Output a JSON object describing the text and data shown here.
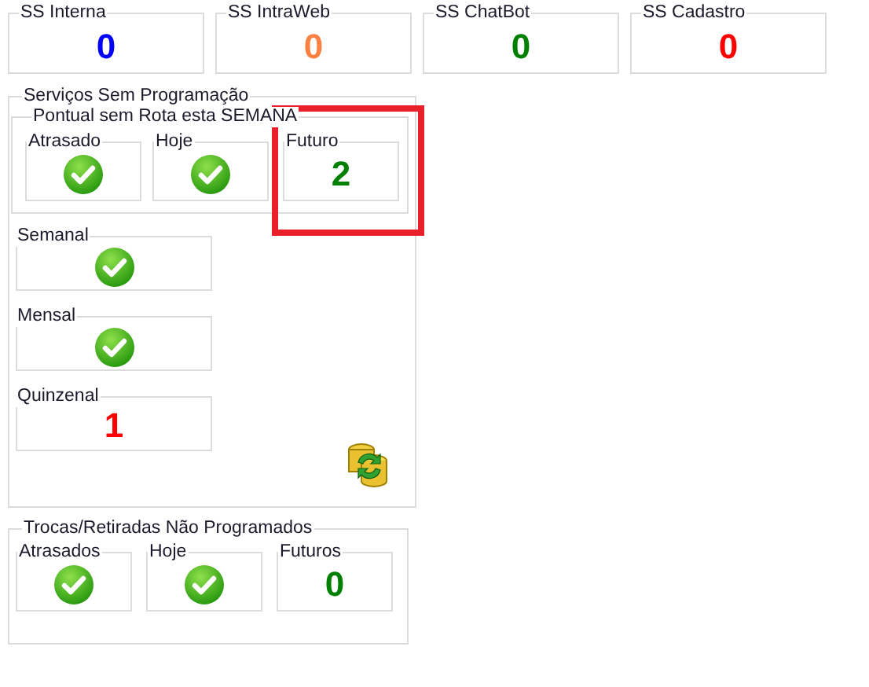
{
  "summary": [
    {
      "label": "SS Interna",
      "kind": "count",
      "value": "0",
      "color": "#0000ff"
    },
    {
      "label": "SS IntraWeb",
      "kind": "count",
      "value": "0",
      "color": "#ff8040"
    },
    {
      "label": "SS ChatBot",
      "kind": "count",
      "value": "0",
      "color": "#008000"
    },
    {
      "label": "SS Cadastro",
      "kind": "count",
      "value": "0",
      "color": "#ff0000"
    }
  ],
  "services": {
    "title": "Serviços Sem Programação",
    "pontual": {
      "title": "Pontual sem Rota esta SEMANA",
      "items": [
        {
          "label": "Atrasado",
          "kind": "ok",
          "highlighted": false
        },
        {
          "label": "Hoje",
          "kind": "ok",
          "highlighted": false
        },
        {
          "label": "Futuro",
          "kind": "count",
          "value": "2",
          "color": "#008000",
          "highlighted": true
        }
      ]
    },
    "periodic": [
      {
        "label": "Semanal",
        "kind": "ok"
      },
      {
        "label": "Mensal",
        "kind": "ok"
      },
      {
        "label": "Quinzenal",
        "kind": "count",
        "value": "1",
        "color": "#ff0000"
      }
    ]
  },
  "trocas": {
    "title": "Trocas/Retiradas Não Programados",
    "items": [
      {
        "label": "Atrasados",
        "kind": "ok"
      },
      {
        "label": "Hoje",
        "kind": "ok"
      },
      {
        "label": "Futuros",
        "kind": "count",
        "value": "0",
        "color": "#008000"
      }
    ]
  }
}
